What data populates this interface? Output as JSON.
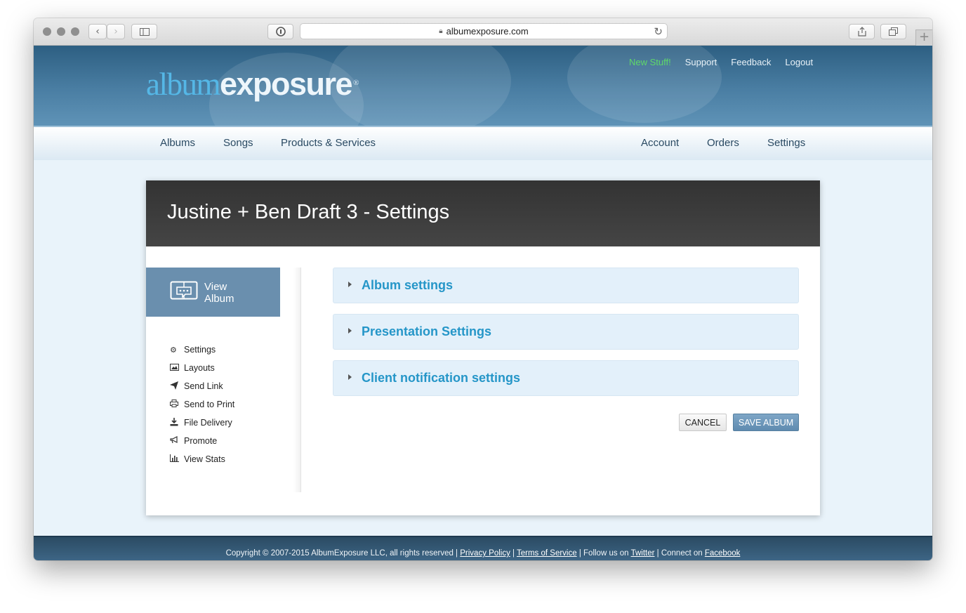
{
  "browser": {
    "url": "albumexposure.com"
  },
  "header": {
    "logo_part1": "album",
    "logo_part2": "exposure",
    "logo_reg": "®",
    "links": {
      "new_stuff": "New Stuff!",
      "support": "Support",
      "feedback": "Feedback",
      "logout": "Logout"
    }
  },
  "nav": {
    "albums": "Albums",
    "songs": "Songs",
    "products": "Products & Services",
    "account": "Account",
    "orders": "Orders",
    "settings": "Settings"
  },
  "page": {
    "title": "Justine + Ben Draft 3 - Settings"
  },
  "sidebar": {
    "view_album_line1": "View",
    "view_album_line2": "Album",
    "items": [
      {
        "label": "Settings",
        "icon": "gear-icon"
      },
      {
        "label": "Layouts",
        "icon": "image-icon"
      },
      {
        "label": "Send Link",
        "icon": "paper-plane-icon"
      },
      {
        "label": "Send to Print",
        "icon": "printer-icon"
      },
      {
        "label": "File Delivery",
        "icon": "download-icon"
      },
      {
        "label": "Promote",
        "icon": "megaphone-icon"
      },
      {
        "label": "View Stats",
        "icon": "bar-chart-icon"
      }
    ]
  },
  "panels": [
    {
      "title": "Album settings"
    },
    {
      "title": "Presentation Settings"
    },
    {
      "title": "Client notification settings"
    }
  ],
  "buttons": {
    "cancel": "CANCEL",
    "save": "SAVE ALBUM"
  },
  "footer": {
    "copyright": "Copyright © 2007-2015 AlbumExposure LLC, all rights reserved | ",
    "privacy": "Privacy Policy",
    "sep1": " | ",
    "terms": "Terms of Service",
    "follow": " | Follow us on ",
    "twitter": "Twitter",
    "connect": " | Connect on ",
    "facebook": "Facebook"
  },
  "colors": {
    "accent": "#2596c8",
    "header_blue": "#2d5f82",
    "new_stuff_green": "#5fd86a",
    "save_button": "#6a93b6"
  }
}
